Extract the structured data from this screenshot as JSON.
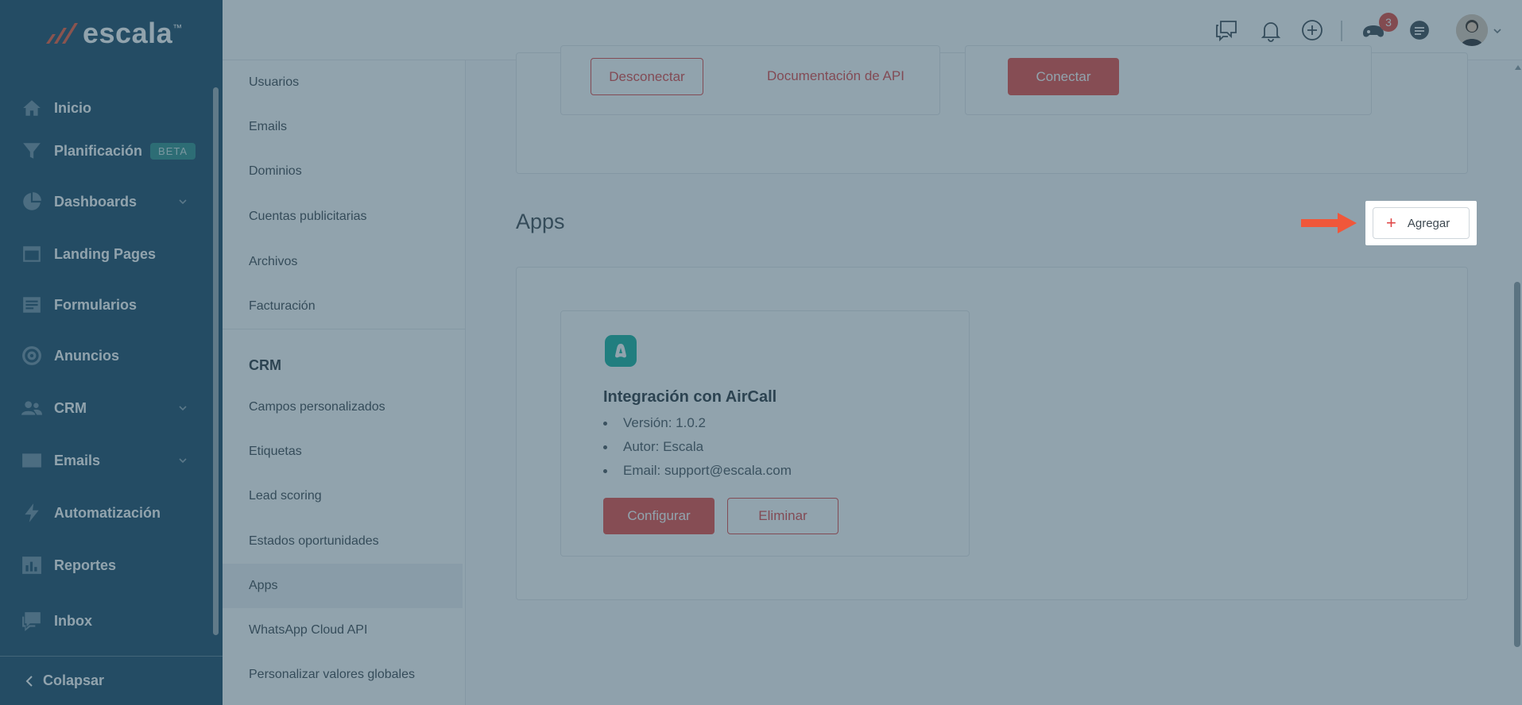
{
  "brand": {
    "name": "escala",
    "tm": "™"
  },
  "nav": {
    "items": [
      {
        "label": "Inicio",
        "icon": "home-icon"
      },
      {
        "label": "Planificación",
        "icon": "filter-icon",
        "badge": "BETA"
      },
      {
        "label": "Dashboards",
        "icon": "pie-chart-icon",
        "expandable": true
      },
      {
        "label": "Landing Pages",
        "icon": "browser-window-icon"
      },
      {
        "label": "Formularios",
        "icon": "form-icon"
      },
      {
        "label": "Anuncios",
        "icon": "target-icon"
      },
      {
        "label": "CRM",
        "icon": "users-icon",
        "expandable": true
      },
      {
        "label": "Emails",
        "icon": "envelope-icon",
        "expandable": true
      },
      {
        "label": "Automatización",
        "icon": "lightning-icon"
      },
      {
        "label": "Reportes",
        "icon": "bar-chart-icon"
      },
      {
        "label": "Inbox",
        "icon": "chat-bubbles-icon"
      }
    ],
    "collapse_label": "Colapsar"
  },
  "topbar": {
    "notification_count": "3"
  },
  "submenu": {
    "items_top": [
      "Usuarios",
      "Emails",
      "Dominios",
      "Cuentas publicitarias",
      "Archivos",
      "Facturación"
    ],
    "crm_heading": "CRM",
    "items_crm": [
      "Campos personalizados",
      "Etiquetas",
      "Lead scoring",
      "Estados oportunidades",
      "Apps",
      "WhatsApp Cloud API",
      "Personalizar valores globales"
    ],
    "active": "Apps"
  },
  "api_section": {
    "disconnect_label": "Desconectar",
    "docs_label": "Documentación de API",
    "connect_label": "Conectar"
  },
  "apps_section": {
    "title": "Apps",
    "add_label": "Agregar",
    "apps": [
      {
        "title": "Integración con AirCall",
        "details": [
          "Versión: 1.0.2",
          "Autor: Escala",
          "Email: support@escala.com"
        ],
        "configure_label": "Configurar",
        "delete_label": "Eliminar"
      }
    ]
  },
  "colors": {
    "nav_bg": "#1c4a66",
    "accent_red": "#e84c45",
    "app_logo": "#16b2a0",
    "overlay": "rgba(44,78,98,0.52)"
  }
}
